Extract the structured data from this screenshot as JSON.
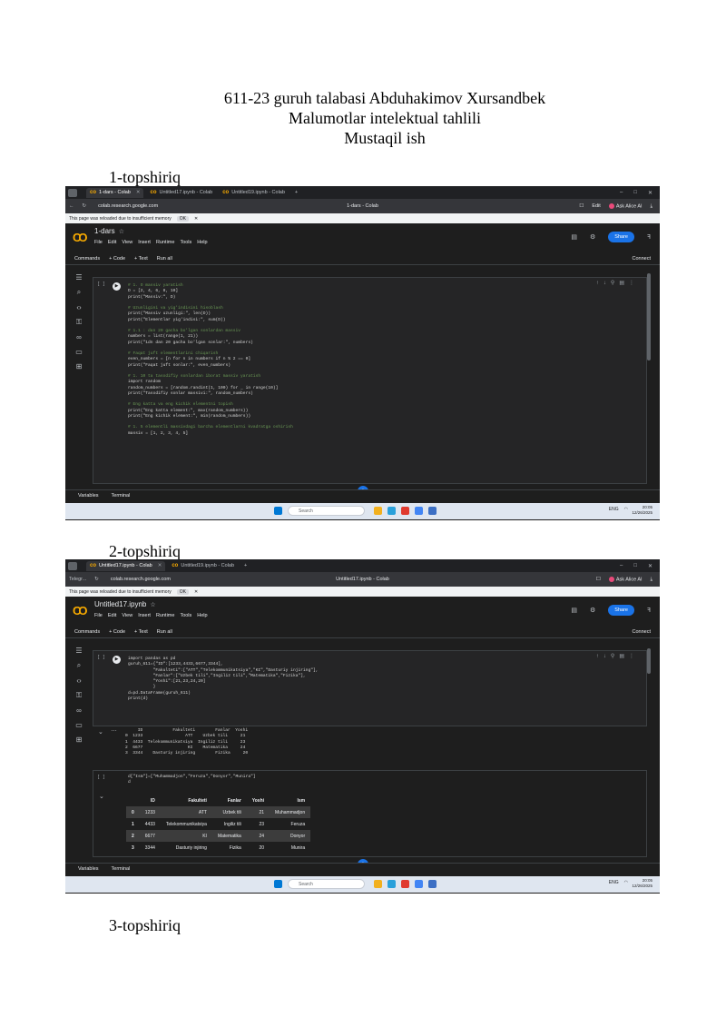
{
  "document": {
    "header_lines": [
      "611-23 guruh talabasi Abduhakimov Xursandbek",
      "Malumotlar intelektual tahlili",
      "Mustaqil ish"
    ],
    "task1_heading": "1-topshiriq",
    "task2_heading": "2-topshiriq",
    "task3_heading": "3-topshiriq"
  },
  "screenshot1": {
    "tabs": [
      "1-dars - Colab",
      "Untitled17.ipynb - Colab",
      "Untitled19.ipynb - Colab"
    ],
    "url": "colab.research.google.com",
    "page_title": "1-dars - Colab",
    "edit_label": "Edit",
    "ask_ai": "Ask Alice AI",
    "info_text": "This page was reloaded due to insufficient memory",
    "info_ok": "OK",
    "notebook_name": "1-dars",
    "menu": [
      "File",
      "Edit",
      "View",
      "Insert",
      "Runtime",
      "Tools",
      "Help"
    ],
    "share": "Share",
    "toolbar": [
      "Commands",
      "+ Code",
      "+ Text",
      "Run all"
    ],
    "connect": "Connect",
    "cell_bracket": "[ ]",
    "code_lines": [
      {
        "cls": "c-com",
        "text": "# 1. O massiv yaratish"
      },
      {
        "cls": "c-txt",
        "text": "D = [2, 4, 6, 8, 10]"
      },
      {
        "cls": "c-txt",
        "text": "print(\"Massiv:\", D)"
      },
      {
        "cls": "c-txt",
        "text": " "
      },
      {
        "cls": "c-com",
        "text": "# Uzunligini va yig'indisini hisoblash"
      },
      {
        "cls": "c-txt",
        "text": "print(\"Massiv uzunligi:\", len(D))"
      },
      {
        "cls": "c-txt",
        "text": "print(\"Elementlar yig'indisi:\", sum(D))"
      },
      {
        "cls": "c-txt",
        "text": " "
      },
      {
        "cls": "c-com",
        "text": "# 1.1 : dan 20 gacha bo'lgan sonlardan massiv"
      },
      {
        "cls": "c-txt",
        "text": "numbers = list(range(1, 21))"
      },
      {
        "cls": "c-txt",
        "text": "print(\"1dn dan 20 gacha bo'lgan sonlar:\", numbers)"
      },
      {
        "cls": "c-txt",
        "text": " "
      },
      {
        "cls": "c-com",
        "text": "# Faqat juft elementlarini chiqarish"
      },
      {
        "cls": "c-txt",
        "text": "even_numbers = [n for n in numbers if n % 2 == 0]"
      },
      {
        "cls": "c-txt",
        "text": "print(\"Faqat juft sonlar:\", even_numbers)"
      },
      {
        "cls": "c-txt",
        "text": " "
      },
      {
        "cls": "c-com",
        "text": "# 1. 10 ta tasodifiy sonlardan iborat massiv yaratish"
      },
      {
        "cls": "c-txt",
        "text": "import random"
      },
      {
        "cls": "c-txt",
        "text": "random_numbers = [random.randint(1, 100) for _ in range(10)]"
      },
      {
        "cls": "c-txt",
        "text": "print(\"Tasodifiy sonlar massivi:\", random_numbers)"
      },
      {
        "cls": "c-txt",
        "text": " "
      },
      {
        "cls": "c-com",
        "text": "# Eng katta va eng kichik elementni topish"
      },
      {
        "cls": "c-txt",
        "text": "print(\"Eng katta element:\", max(random_numbers))"
      },
      {
        "cls": "c-txt",
        "text": "print(\"Eng kichik element:\", min(random_numbers))"
      },
      {
        "cls": "c-txt",
        "text": " "
      },
      {
        "cls": "c-com",
        "text": "# 1. 5 elementli massivdagi barcha elementlarni kvadratga oshirish"
      },
      {
        "cls": "c-txt",
        "text": "massiv = [1, 2, 3, 4, 5]"
      }
    ],
    "bottom": [
      "Variables",
      "Terminal"
    ],
    "taskbar_search": "Search",
    "lang": "ENG",
    "time": "20:05",
    "date": "12/26/2025"
  },
  "screenshot2": {
    "tabs": [
      "Telegr...",
      "Untitled17.ipynb - Colab",
      "Untitled19.ipynb - Colab"
    ],
    "url": "colab.research.google.com",
    "page_title": "Untitled17.ipynb - Colab",
    "ask_ai": "Ask Alice AI",
    "info_text": "This page was reloaded due to insufficient memory",
    "info_ok": "OK",
    "notebook_name": "Untitled17.ipynb",
    "menu": [
      "File",
      "Edit",
      "View",
      "Insert",
      "Runtime",
      "Tools",
      "Help"
    ],
    "share": "Share",
    "toolbar": [
      "Commands",
      "+ Code",
      "+ Text",
      "Run all"
    ],
    "connect": "Connect",
    "cell_bracket": "[ ]",
    "code_lines": [
      {
        "cls": "c-txt",
        "text": "import pandas as pd"
      },
      {
        "cls": "c-txt",
        "text": "guruh_611={\"ID\":[1233,4433,6677,3344],"
      },
      {
        "cls": "c-txt",
        "text": "          \"Fakulteti\":[\"ATT\",\"Telekommunikatsiya\",\"KI\",\"Dasturiy injiring\"],"
      },
      {
        "cls": "c-txt",
        "text": "          \"Fanlar\":[\"Uzbek tili\",\"Ingiliz tili\",\"Matematika\",\"Fizika\"],"
      },
      {
        "cls": "c-txt",
        "text": "          \"Yoshi\":[21,23,24,20]"
      },
      {
        "cls": "c-txt",
        "text": "          }"
      },
      {
        "cls": "c-txt",
        "text": "d=pd.DataFrame(guruh_611)"
      },
      {
        "cls": "c-txt",
        "text": "print(d)"
      }
    ],
    "print_output": [
      "     ID            Fakulteti        Fanlar  Yoshi",
      "0  1233                 ATT    Uzbek tili     21",
      "1  4433  Telekommunikatsiya  Ingiliz tili     23",
      "2  6677                  KI    Matematika     24",
      "3  3344    Dasturiy injiring        Fizika     20"
    ],
    "cell2_code": "d[\"Ism\"]=[\"Muhammadjon\",\"Feruza\",\"Donyor\",\"Munira\"]",
    "cell2_code2": "d",
    "table_headers": [
      "",
      "ID",
      "Fakulteti",
      "Fanlar",
      "Yoshi",
      "Ism"
    ],
    "table_rows": [
      [
        "0",
        "1233",
        "ATT",
        "Uzbek tili",
        "21",
        "Muhammadjon"
      ],
      [
        "1",
        "4433",
        "Telekommunikatsiya",
        "Ingiliz tili",
        "23",
        "Feruza"
      ],
      [
        "2",
        "6677",
        "KI",
        "Matematika",
        "24",
        "Donyor"
      ],
      [
        "3",
        "3344",
        "Dasturiy injiring",
        "Fizika",
        "20",
        "Munira"
      ]
    ],
    "bottom": [
      "Variables",
      "Terminal"
    ],
    "taskbar_search": "Search",
    "lang": "ENG",
    "time": "20:05",
    "date": "12/26/2025"
  }
}
